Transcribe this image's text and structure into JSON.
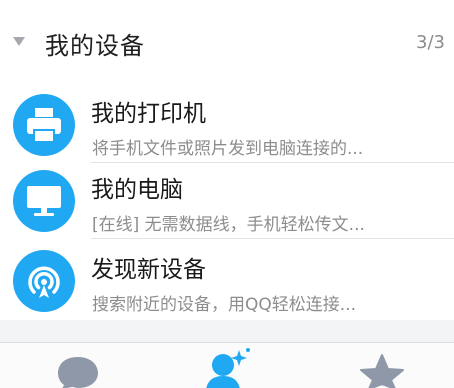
{
  "group": {
    "title": "我的设备",
    "count": "3/3"
  },
  "devices": [
    {
      "name": "我的打印机",
      "description": "将手机文件或照片发到电脑连接的...",
      "icon": "printer-icon"
    },
    {
      "name": "我的电脑",
      "description": "[在线] 无需数据线，手机轻松传文...",
      "icon": "monitor-icon"
    },
    {
      "name": "发现新设备",
      "description": "搜索附近的设备，用QQ轻松连接...",
      "icon": "nearby-signal-icon"
    }
  ],
  "tabbar": {
    "tabs": [
      {
        "icon": "chat-bubble-icon",
        "active": false
      },
      {
        "icon": "contacts-person-icon",
        "active": true
      },
      {
        "icon": "star-icon",
        "active": false
      }
    ]
  },
  "colors": {
    "accent": "#21a8f3",
    "inactive_icon": "#8e98a8",
    "text_primary": "#1a1a1a",
    "text_secondary": "#8d8d8d"
  }
}
